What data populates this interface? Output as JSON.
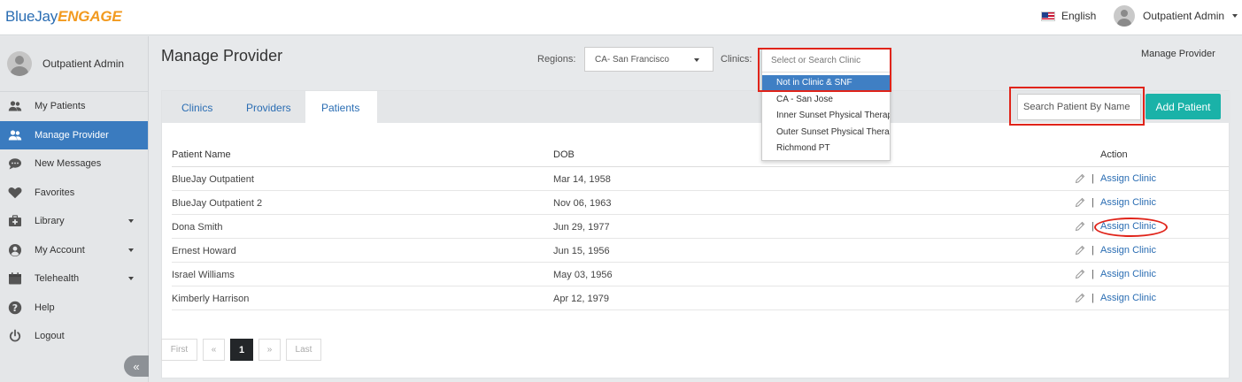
{
  "header": {
    "logo_main": "BlueJay",
    "logo_accent": "ENGAGE",
    "language": "English",
    "user_name": "Outpatient Admin"
  },
  "sidebar": {
    "user_name": "Outpatient Admin",
    "items": [
      {
        "label": "My Patients",
        "icon": "users-icon",
        "active": false
      },
      {
        "label": "Manage Provider",
        "icon": "users-icon",
        "active": true
      },
      {
        "label": "New Messages",
        "icon": "chat-bubble-icon",
        "active": false
      },
      {
        "label": "Favorites",
        "icon": "heart-icon",
        "active": false
      },
      {
        "label": "Library",
        "icon": "medical-kit-icon",
        "active": false,
        "expandable": true
      },
      {
        "label": "My Account",
        "icon": "user-circle-icon",
        "active": false,
        "expandable": true
      },
      {
        "label": "Telehealth",
        "icon": "calendar-icon",
        "active": false,
        "expandable": true
      },
      {
        "label": "Help",
        "icon": "help-icon",
        "active": false
      },
      {
        "label": "Logout",
        "icon": "power-icon",
        "active": false
      }
    ],
    "collapse_label": "«"
  },
  "main": {
    "title": "Manage Provider",
    "regions_label": "Regions:",
    "region_value": "CA- San Francisco",
    "clinics_label": "Clinics:",
    "clinic_search_placeholder": "Select or Search Clinic",
    "clinic_options": [
      "Not in Clinic & SNF",
      "CA - San Jose",
      "Inner Sunset Physical Therapy",
      "Outer Sunset Physical Therapy",
      "Richmond PT"
    ],
    "clinic_selected_index": 0,
    "top_right_label": "Manage Provider",
    "tabs": [
      {
        "label": "Clinics",
        "active": false
      },
      {
        "label": "Providers",
        "active": false
      },
      {
        "label": "Patients",
        "active": true
      }
    ],
    "search_placeholder": "Search Patient By Name",
    "add_button": "Add Patient",
    "table": {
      "headers": [
        "Patient Name",
        "DOB",
        "Action"
      ],
      "action_sep": "|",
      "rows": [
        {
          "name": "BlueJay Outpatient",
          "dob": "Mar 14, 1958",
          "action": "Assign Clinic"
        },
        {
          "name": "BlueJay Outpatient 2",
          "dob": "Nov 06, 1963",
          "action": "Assign Clinic"
        },
        {
          "name": "Dona Smith",
          "dob": "Jun 29, 1977",
          "action": "Assign Clinic"
        },
        {
          "name": "Ernest Howard",
          "dob": "Jun 15, 1956",
          "action": "Assign Clinic"
        },
        {
          "name": "Israel Williams",
          "dob": "May 03, 1956",
          "action": "Assign Clinic"
        },
        {
          "name": "Kimberly Harrison",
          "dob": "Apr 12, 1979",
          "action": "Assign Clinic"
        }
      ]
    },
    "pagination": {
      "first": "First",
      "prev": "«",
      "current": "1",
      "next": "»",
      "last": "Last"
    }
  },
  "colors": {
    "brand_blue": "#2a6db3",
    "brand_orange": "#f29a1f",
    "active_nav": "#3a7bbf",
    "add_button": "#1ab2a8",
    "annotation_red": "#e0241a"
  }
}
